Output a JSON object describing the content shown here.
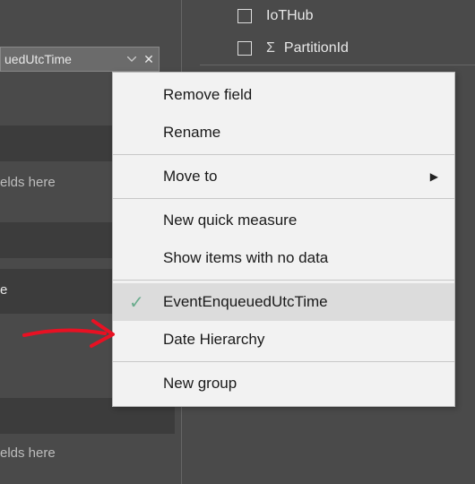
{
  "leftPanel": {
    "chipLabel": "uedUtcTime",
    "placeholder1": "elds here",
    "placeholder2": "elds here",
    "rowText": "e"
  },
  "rightPanel": {
    "fields": [
      {
        "label": "IoTHub",
        "hasSigma": false
      },
      {
        "label": "PartitionId",
        "hasSigma": true
      }
    ]
  },
  "contextMenu": {
    "items": {
      "removeField": "Remove field",
      "rename": "Rename",
      "moveTo": "Move to",
      "newQuickMeasure": "New quick measure",
      "showItemsNoData": "Show items with no data",
      "eventEnqueued": "EventEnqueuedUtcTime",
      "dateHierarchy": "Date Hierarchy",
      "newGroup": "New group"
    }
  }
}
